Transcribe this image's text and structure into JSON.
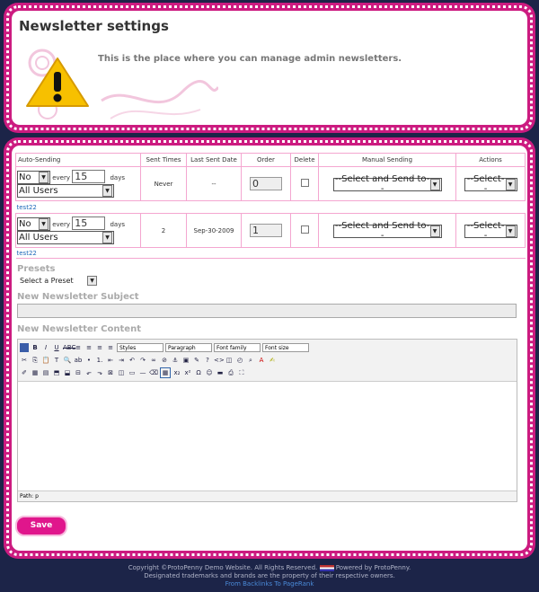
{
  "header": {
    "title": "Newsletter settings",
    "description": "This is the place where you can manage admin newsletters."
  },
  "table": {
    "columns": [
      "Auto-Sending",
      "Sent Times",
      "Last Sent Date",
      "Order",
      "Delete",
      "Manual Sending",
      "Actions"
    ],
    "rows": [
      {
        "auto": "No",
        "every": "every",
        "days_value": "15",
        "days": "days",
        "users": "All Users",
        "sent_times": "Never",
        "last_sent": "--",
        "order": "0",
        "manual": "--Select and Send to--",
        "actions": "--Select--",
        "link": "test22"
      },
      {
        "auto": "No",
        "every": "every",
        "days_value": "15",
        "days": "days",
        "users": "All Users",
        "sent_times": "2",
        "last_sent": "Sep-30-2009",
        "order": "1",
        "manual": "--Select and Send to--",
        "actions": "--Select--",
        "link": "test22"
      }
    ]
  },
  "presets": {
    "label": "Presets",
    "value": "Select a Preset"
  },
  "subject": {
    "label": "New Newsletter Subject",
    "value": ""
  },
  "content": {
    "label": "New Newsletter Content",
    "dropdowns": [
      "Styles",
      "Paragraph",
      "Font family",
      "Font size"
    ],
    "path": "Path: p"
  },
  "save_label": "Save",
  "footer": {
    "line1a": "Copyright ©ProtoPenny Demo Website. All Rights Reserved.",
    "line1b": "Powered by ProtoPenny.",
    "line2": "Designated trademarks and brands are the property of their respective owners.",
    "line3": "From Backlinks To PageRank"
  },
  "colors": {
    "accent": "#cc1b80",
    "background": "#1c2448",
    "save": "#e0168c"
  }
}
